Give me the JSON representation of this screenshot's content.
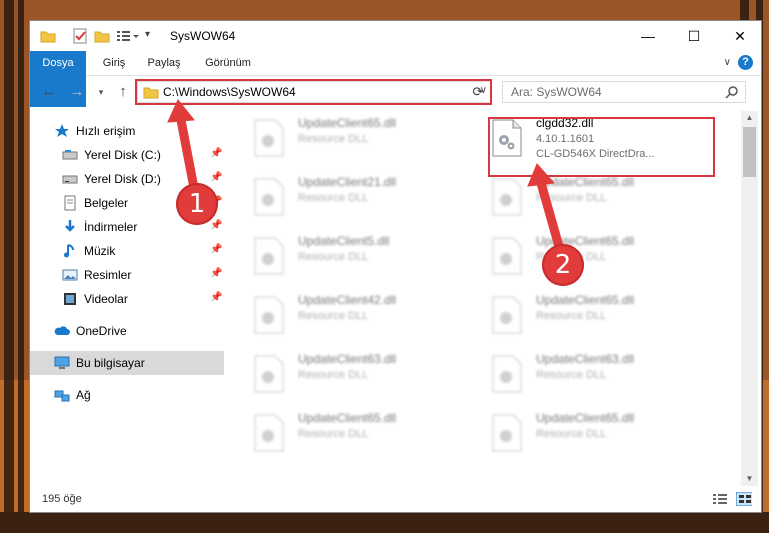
{
  "window": {
    "title": "SysWOW64",
    "controls": {
      "minimize": "—",
      "maximize": "☐",
      "close": "✕"
    }
  },
  "ribbon": {
    "tabs": [
      "Dosya",
      "Giriş",
      "Paylaş",
      "Görünüm"
    ],
    "help": "?"
  },
  "address": {
    "path": "C:\\Windows\\SysWOW64",
    "search_placeholder": "Ara: SysWOW64"
  },
  "nav": {
    "items": [
      {
        "label": "Hızlı erişim",
        "icon": "star-icon",
        "pinned": false
      },
      {
        "label": "Yerel Disk (C:)",
        "icon": "drive-icon",
        "pinned": true
      },
      {
        "label": "Yerel Disk (D:)",
        "icon": "drive-icon",
        "pinned": true
      },
      {
        "label": "Belgeler",
        "icon": "documents-icon",
        "pinned": true
      },
      {
        "label": "İndirmeler",
        "icon": "download-icon",
        "pinned": true
      },
      {
        "label": "Müzik",
        "icon": "music-icon",
        "pinned": true
      },
      {
        "label": "Resimler",
        "icon": "pictures-icon",
        "pinned": true
      },
      {
        "label": "Videolar",
        "icon": "video-icon",
        "pinned": true
      },
      {
        "label": "OneDrive",
        "icon": "cloud-icon",
        "pinned": false
      },
      {
        "label": "Bu bilgisayar",
        "icon": "computer-icon",
        "pinned": false
      },
      {
        "label": "Ağ",
        "icon": "network-icon",
        "pinned": false
      }
    ]
  },
  "files": {
    "left": [
      {
        "name": "UpdateClient65.dll",
        "desc": "Resource DLL"
      },
      {
        "name": "UpdateClient21.dll",
        "desc": "Resource DLL"
      },
      {
        "name": "UpdateClient5.dll",
        "desc": "Resource DLL"
      },
      {
        "name": "UpdateClient42.dll",
        "desc": "Resource DLL"
      },
      {
        "name": "UpdateClient63.dll",
        "desc": "Resource DLL"
      },
      {
        "name": "UpdateClient65.dll",
        "desc": "Resource DLL"
      }
    ],
    "right": [
      {
        "name": "UpdateClient65.dll",
        "desc": "Resource DLL"
      },
      {
        "name": "UpdateClient65.dll",
        "desc": "Resource DLL"
      },
      {
        "name": "UpdateClient65.dll",
        "desc": "Resource DLL"
      },
      {
        "name": "UpdateClient63.dll",
        "desc": "Resource DLL"
      },
      {
        "name": "UpdateClient65.dll",
        "desc": "Resource DLL"
      }
    ],
    "highlighted": {
      "name": "clgdd32.dll",
      "version": "4.10.1.1601",
      "desc": "CL-GD546X DirectDra..."
    }
  },
  "status": {
    "count": "195 öğe"
  },
  "callouts": {
    "one": "1",
    "two": "2"
  },
  "colors": {
    "accent": "#1979ca",
    "highlight": "#d7373f",
    "callout": "#e23b3b"
  }
}
